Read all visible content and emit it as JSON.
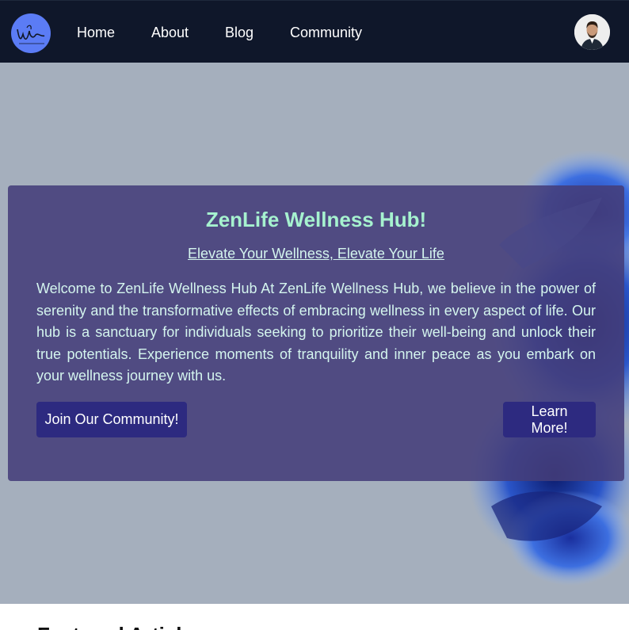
{
  "nav": {
    "links": [
      {
        "label": "Home"
      },
      {
        "label": "About"
      },
      {
        "label": "Blog"
      },
      {
        "label": "Community"
      }
    ]
  },
  "hero": {
    "title": "ZenLife Wellness Hub!",
    "subtitle": "Elevate Your Wellness, Elevate Your Life",
    "body": "Welcome to ZenLife Wellness Hub At ZenLife Wellness Hub, we believe in the power of serenity and the transformative effects of embracing wellness in every aspect of life. Our hub is a sanctuary for individuals seeking to prioritize their well-being and unlock their true potentials. Experience moments of tranquility and inner peace as you embark on your wellness journey with us.",
    "join_button": "Join Our Community!",
    "learn_button": "Learn More!"
  },
  "featured": {
    "title": "Featured Articles"
  },
  "colors": {
    "navbar_bg": "#0f172a",
    "hero_bg": "#a5afbd",
    "card_bg": "#443e7a",
    "title_color": "#a6f2cf",
    "button_bg": "#2d2a80",
    "logo_bg": "#5b7cf5"
  },
  "icons": {
    "logo": "signature-logo-icon",
    "avatar": "user-avatar"
  }
}
